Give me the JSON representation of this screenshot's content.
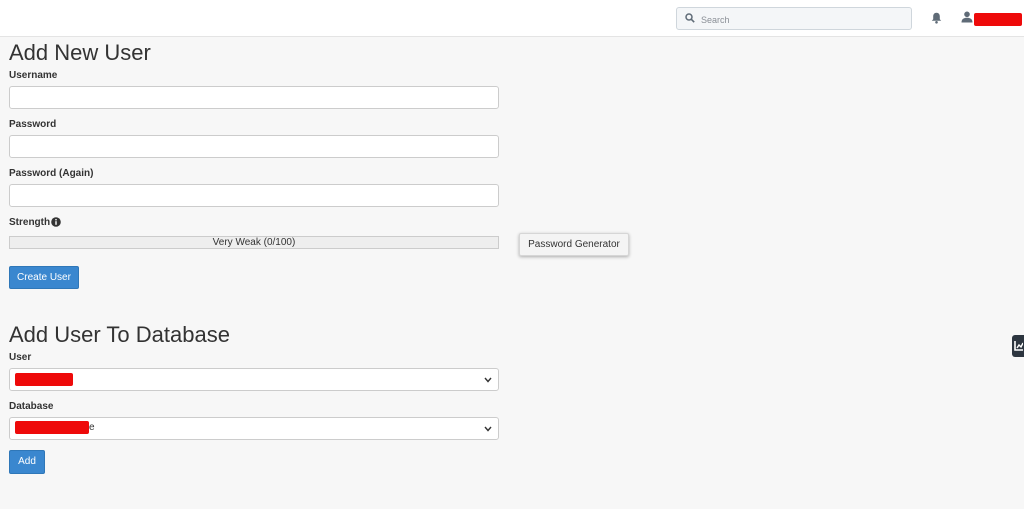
{
  "header": {
    "search_placeholder": "Search",
    "icons": [
      "search-icon",
      "bell-icon",
      "user-icon"
    ]
  },
  "add_user": {
    "title": "Add New User",
    "username_label": "Username",
    "password_label": "Password",
    "password_again_label": "Password (Again)",
    "strength_label": "Strength",
    "strength_text": "Very Weak (0/100)",
    "strength_value": 0,
    "password_generator_label": "Password Generator",
    "create_button_label": "Create User"
  },
  "add_to_db": {
    "title": "Add User To Database",
    "user_label": "User",
    "database_label": "Database",
    "database_visible_suffix": "e",
    "add_button_label": "Add"
  },
  "colors": {
    "primary": "#3a87cf",
    "redaction": "#ee0a0a",
    "sidebar_tab": "#2d3640"
  }
}
